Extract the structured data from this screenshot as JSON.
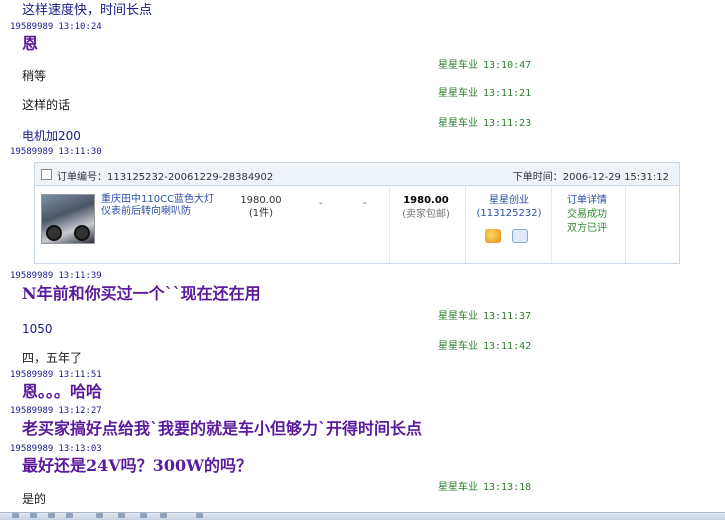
{
  "participants": {
    "buyer": "19589989",
    "seller": "星星车业"
  },
  "messages": [
    {
      "id": "m0",
      "text": "这样速度快，时间长点"
    },
    {
      "id": "m1",
      "time": "13:10:24",
      "text": "恩"
    },
    {
      "id": "m2",
      "time": "13:10:47",
      "text": "稍等"
    },
    {
      "id": "m3",
      "time": "13:11:21",
      "text": "这样的话"
    },
    {
      "id": "m4",
      "time": "13:11:23",
      "text": "电机加200"
    },
    {
      "id": "m5",
      "time": "13:11:30"
    },
    {
      "id": "m6",
      "time": "13:11:39",
      "text": "N年前和你买过一个``现在还在用"
    },
    {
      "id": "m7",
      "time": "13:11:37",
      "text": "1050"
    },
    {
      "id": "m8",
      "time": "13:11:42",
      "text": "四，五年了"
    },
    {
      "id": "m9",
      "time": "13:11:51",
      "text": "恩。。。哈哈"
    },
    {
      "id": "m10",
      "time": "13:12:27",
      "text": "老买家搞好点给我`我要的就是车小但够力`开得时间长点"
    },
    {
      "id": "m11",
      "time": "13:13:03",
      "text": "最好还是24V吗？300W的吗？"
    },
    {
      "id": "m12",
      "time": "13:13:18",
      "text": "是的"
    }
  ],
  "order": {
    "number_label": "订单编号：113125232-20061229-28384902",
    "time_label": "下单时间：2006-12-29 15:31:12",
    "product_title": "重庆田中110CC蓝色大灯仪表前后转向喇叭防",
    "unit_price": "1980.00",
    "quantity": "(1件)",
    "dash_a": "-",
    "dash_b": "-",
    "total": "1980.00",
    "shipping": "(卖家包邮)",
    "seller_name": "星星创业",
    "seller_id": "(113125232)",
    "detail_link": "订单详情",
    "status_1": "交易成功",
    "status_2": "双方已评"
  }
}
